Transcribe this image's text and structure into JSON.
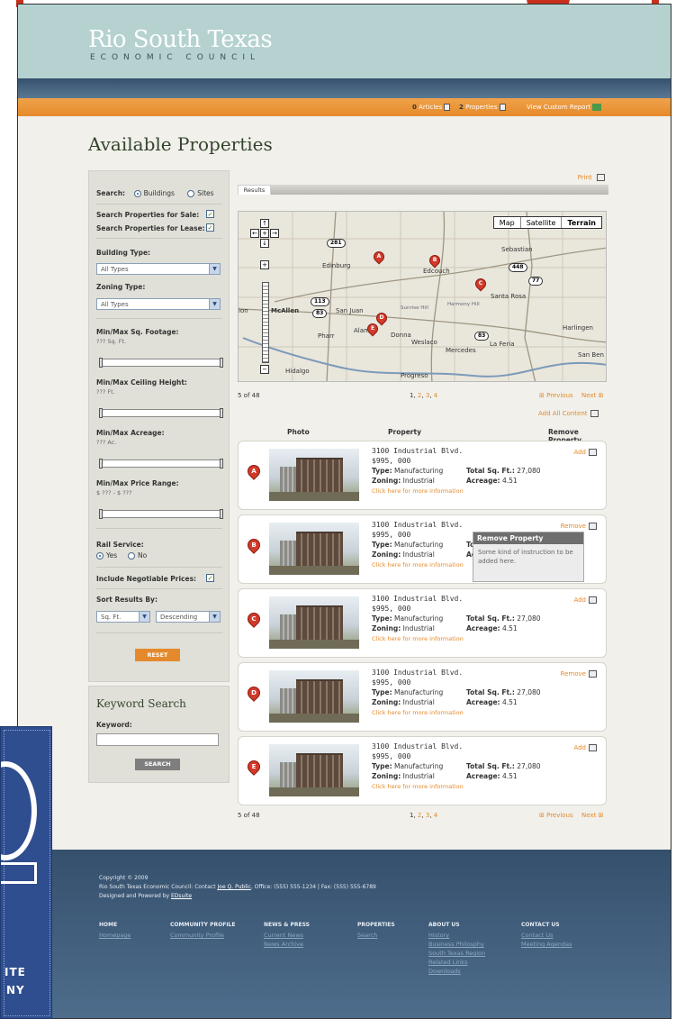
{
  "header": {
    "title": "Rio South Texas",
    "subtitle": "ECONOMIC COUNCIL"
  },
  "topbar": {
    "articles_count": "0",
    "articles_label": "Articles",
    "properties_count": "2",
    "properties_label": "Properties",
    "report_label": "View Custom Report"
  },
  "page_title": "Available Properties",
  "search": {
    "label": "Search:",
    "opt_buildings": "Buildings",
    "opt_sites": "Sites",
    "selected": "Buildings",
    "sale_label": "Search Properties for Sale:",
    "lease_label": "Search Properties for Lease:",
    "building_type_label": "Building Type:",
    "building_type_value": "All Types",
    "zoning_type_label": "Zoning Type:",
    "zoning_type_value": "All Types",
    "sqft_label": "Min/Max Sq. Footage:",
    "sqft_value": "??? Sq. Ft.",
    "ceiling_label": "Min/Max Ceiling Height:",
    "ceiling_value": "??? Ft.",
    "acreage_label": "Min/Max Acreage:",
    "acreage_value": "??? Ac.",
    "price_label": "Min/Max Price Range:",
    "price_value": "$ ??? - $ ???",
    "rail_label": "Rail Service:",
    "rail_yes": "Yes",
    "rail_no": "No",
    "negotiable_label": "Include Negotiable Prices:",
    "sort_label": "Sort Results By:",
    "sort_field": "Sq. Ft.",
    "sort_order": "Descending",
    "reset_label": "RESET"
  },
  "keyword": {
    "title": "Keyword Search",
    "label": "Keyword:",
    "button": "SEARCH"
  },
  "results": {
    "tab_label": "Results",
    "print_label": "Print",
    "count": "5 of 48",
    "page_1": "1",
    "page_2": "2",
    "page_3": "3",
    "page_4": "4",
    "previous": "Previous",
    "next": "Next",
    "add_all": "Add All Content",
    "col_photo": "Photo",
    "col_property": "Property",
    "col_remove": "Remove Property"
  },
  "map": {
    "btn_map": "Map",
    "btn_satellite": "Satellite",
    "btn_terrain": "Terrain",
    "places": {
      "edinburg": "Edinburg",
      "edcouch": "Edcouch",
      "sebastian": "Sebastian",
      "santa_rosa": "Santa Rosa",
      "mcallen": "McAllen",
      "san_juan": "San Juan",
      "pharr": "Pharr",
      "alamo": "Alamo",
      "donna": "Donna",
      "weslaco": "Weslaco",
      "mercedes": "Mercedes",
      "la_feria": "La Feria",
      "harlingen": "Harlingen",
      "san_ben": "San Ben",
      "hidalgo": "Hidalgo",
      "progreso": "Progreso",
      "sunrise_hill": "Sunrise Hill",
      "harmony_hill": "Harmony Hill",
      "mission": "ion"
    },
    "hwys": {
      "h281": "281",
      "h448": "448",
      "h77": "77",
      "h113": "113",
      "h83a": "83",
      "h83b": "83"
    },
    "markers": [
      "A",
      "B",
      "C",
      "D",
      "E"
    ]
  },
  "properties": [
    {
      "marker": "A",
      "address": "3100 Industrial Blvd.",
      "price": "$995, 000",
      "type_label": "Type:",
      "type": "Manufacturing",
      "zoning_label": "Zoning:",
      "zoning": "Industrial",
      "sqft_label": "Total Sq. Ft.:",
      "sqft": "27,080",
      "acreage_label": "Acreage:",
      "acreage": "4.51",
      "more": "Click here for more information",
      "action": "Add"
    },
    {
      "marker": "B",
      "address": "3100 Industrial Blvd.",
      "price": "$995, 000",
      "type_label": "Type:",
      "type": "Manufacturing",
      "zoning_label": "Zoning:",
      "zoning": "Industrial",
      "sqft_label": "To",
      "sqft": "",
      "acreage_label": "Ac",
      "acreage": "",
      "more": "Click here for more information",
      "action": "Remove"
    },
    {
      "marker": "C",
      "address": "3100 Industrial Blvd.",
      "price": "$995, 000",
      "type_label": "Type:",
      "type": "Manufacturing",
      "zoning_label": "Zoning:",
      "zoning": "Industrial",
      "sqft_label": "Total Sq. Ft.:",
      "sqft": "27,080",
      "acreage_label": "Acreage:",
      "acreage": "4.51",
      "more": "Click here for more information",
      "action": "Add"
    },
    {
      "marker": "D",
      "address": "3100 Industrial Blvd.",
      "price": "$995, 000",
      "type_label": "Type:",
      "type": "Manufacturing",
      "zoning_label": "Zoning:",
      "zoning": "Industrial",
      "sqft_label": "Total Sq. Ft.:",
      "sqft": "27,080",
      "acreage_label": "Acreage:",
      "acreage": "4.51",
      "more": "Click here for more information",
      "action": "Remove"
    },
    {
      "marker": "E",
      "address": "3100 Industrial Blvd.",
      "price": "$995, 000",
      "type_label": "Type:",
      "type": "Manufacturing",
      "zoning_label": "Zoning:",
      "zoning": "Industrial",
      "sqft_label": "Total Sq. Ft.:",
      "sqft": "27,080",
      "acreage_label": "Acreage:",
      "acreage": "4.51",
      "more": "Click here for more information",
      "action": "Add"
    }
  ],
  "tooltip": {
    "title": "Remove Property",
    "body": "Some kind of instruction to be added here."
  },
  "footer": {
    "copyright": "Copyright © 2009",
    "contact_prefix": "Rio South Texas Economic Council: Contact",
    "contact_name": "Joe Q. Public",
    "contact_suffix": ", Office: (555) 555-1234 | Fax: (555) 555-6789",
    "designed_prefix": "Designed and Powered by",
    "designed_link": "EDsuite",
    "cols": [
      {
        "head": "HOME",
        "links": [
          "Homepage"
        ]
      },
      {
        "head": "COMMUNITY PROFILE",
        "links": [
          "Community Profile"
        ]
      },
      {
        "head": "NEWS & PRESS",
        "links": [
          "Current News",
          "News Archive"
        ]
      },
      {
        "head": "PROPERTIES",
        "links": [
          "Search"
        ]
      },
      {
        "head": "ABOUT US",
        "links": [
          "History",
          "Business Philosphy",
          "South Texas Region",
          "Related Links",
          "Downloads"
        ]
      },
      {
        "head": "CONTACT US",
        "links": [
          "Contact Us",
          "Meeting Agendas"
        ]
      }
    ]
  },
  "badge": {
    "line1": "ITE",
    "line2": "NY"
  },
  "colors": {
    "accent": "#e58a2c",
    "header": "#b5d2d1",
    "navy": "#35506d",
    "marker": "#d23a2a"
  }
}
